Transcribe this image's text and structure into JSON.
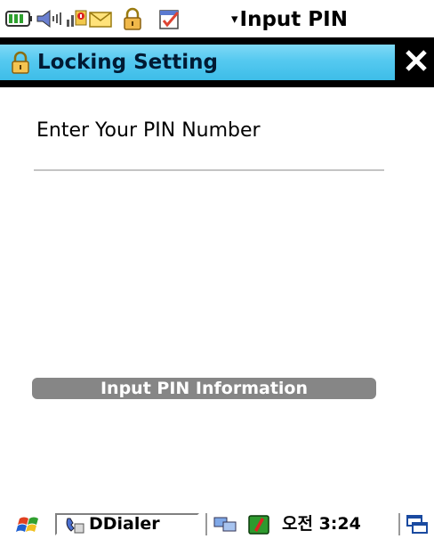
{
  "status_bar": {
    "title": "Input PIN",
    "arrow": "▾",
    "icons": [
      "battery-icon",
      "volume-icon",
      "signal-icon",
      "message-icon",
      "lock-icon",
      "calendar-icon"
    ]
  },
  "title_bar": {
    "title": "Locking Setting",
    "close_label": "✕"
  },
  "content": {
    "pin_label": "Enter Your PIN Number",
    "pin_value": "",
    "info_bar_label": "Input PIN Information"
  },
  "taskbar": {
    "app_label": "DDialer",
    "clock": "오전 3:24",
    "icons": [
      "start-icon",
      "phone-app-icon",
      "network-icon",
      "green-app-icon",
      "windows-icon"
    ]
  },
  "colors": {
    "title_bar_gradient_top": "#7fd9f6",
    "title_bar_gradient_bottom": "#3dbde8",
    "info_bar": "#868686",
    "input_underline": "#c4c4c4"
  }
}
